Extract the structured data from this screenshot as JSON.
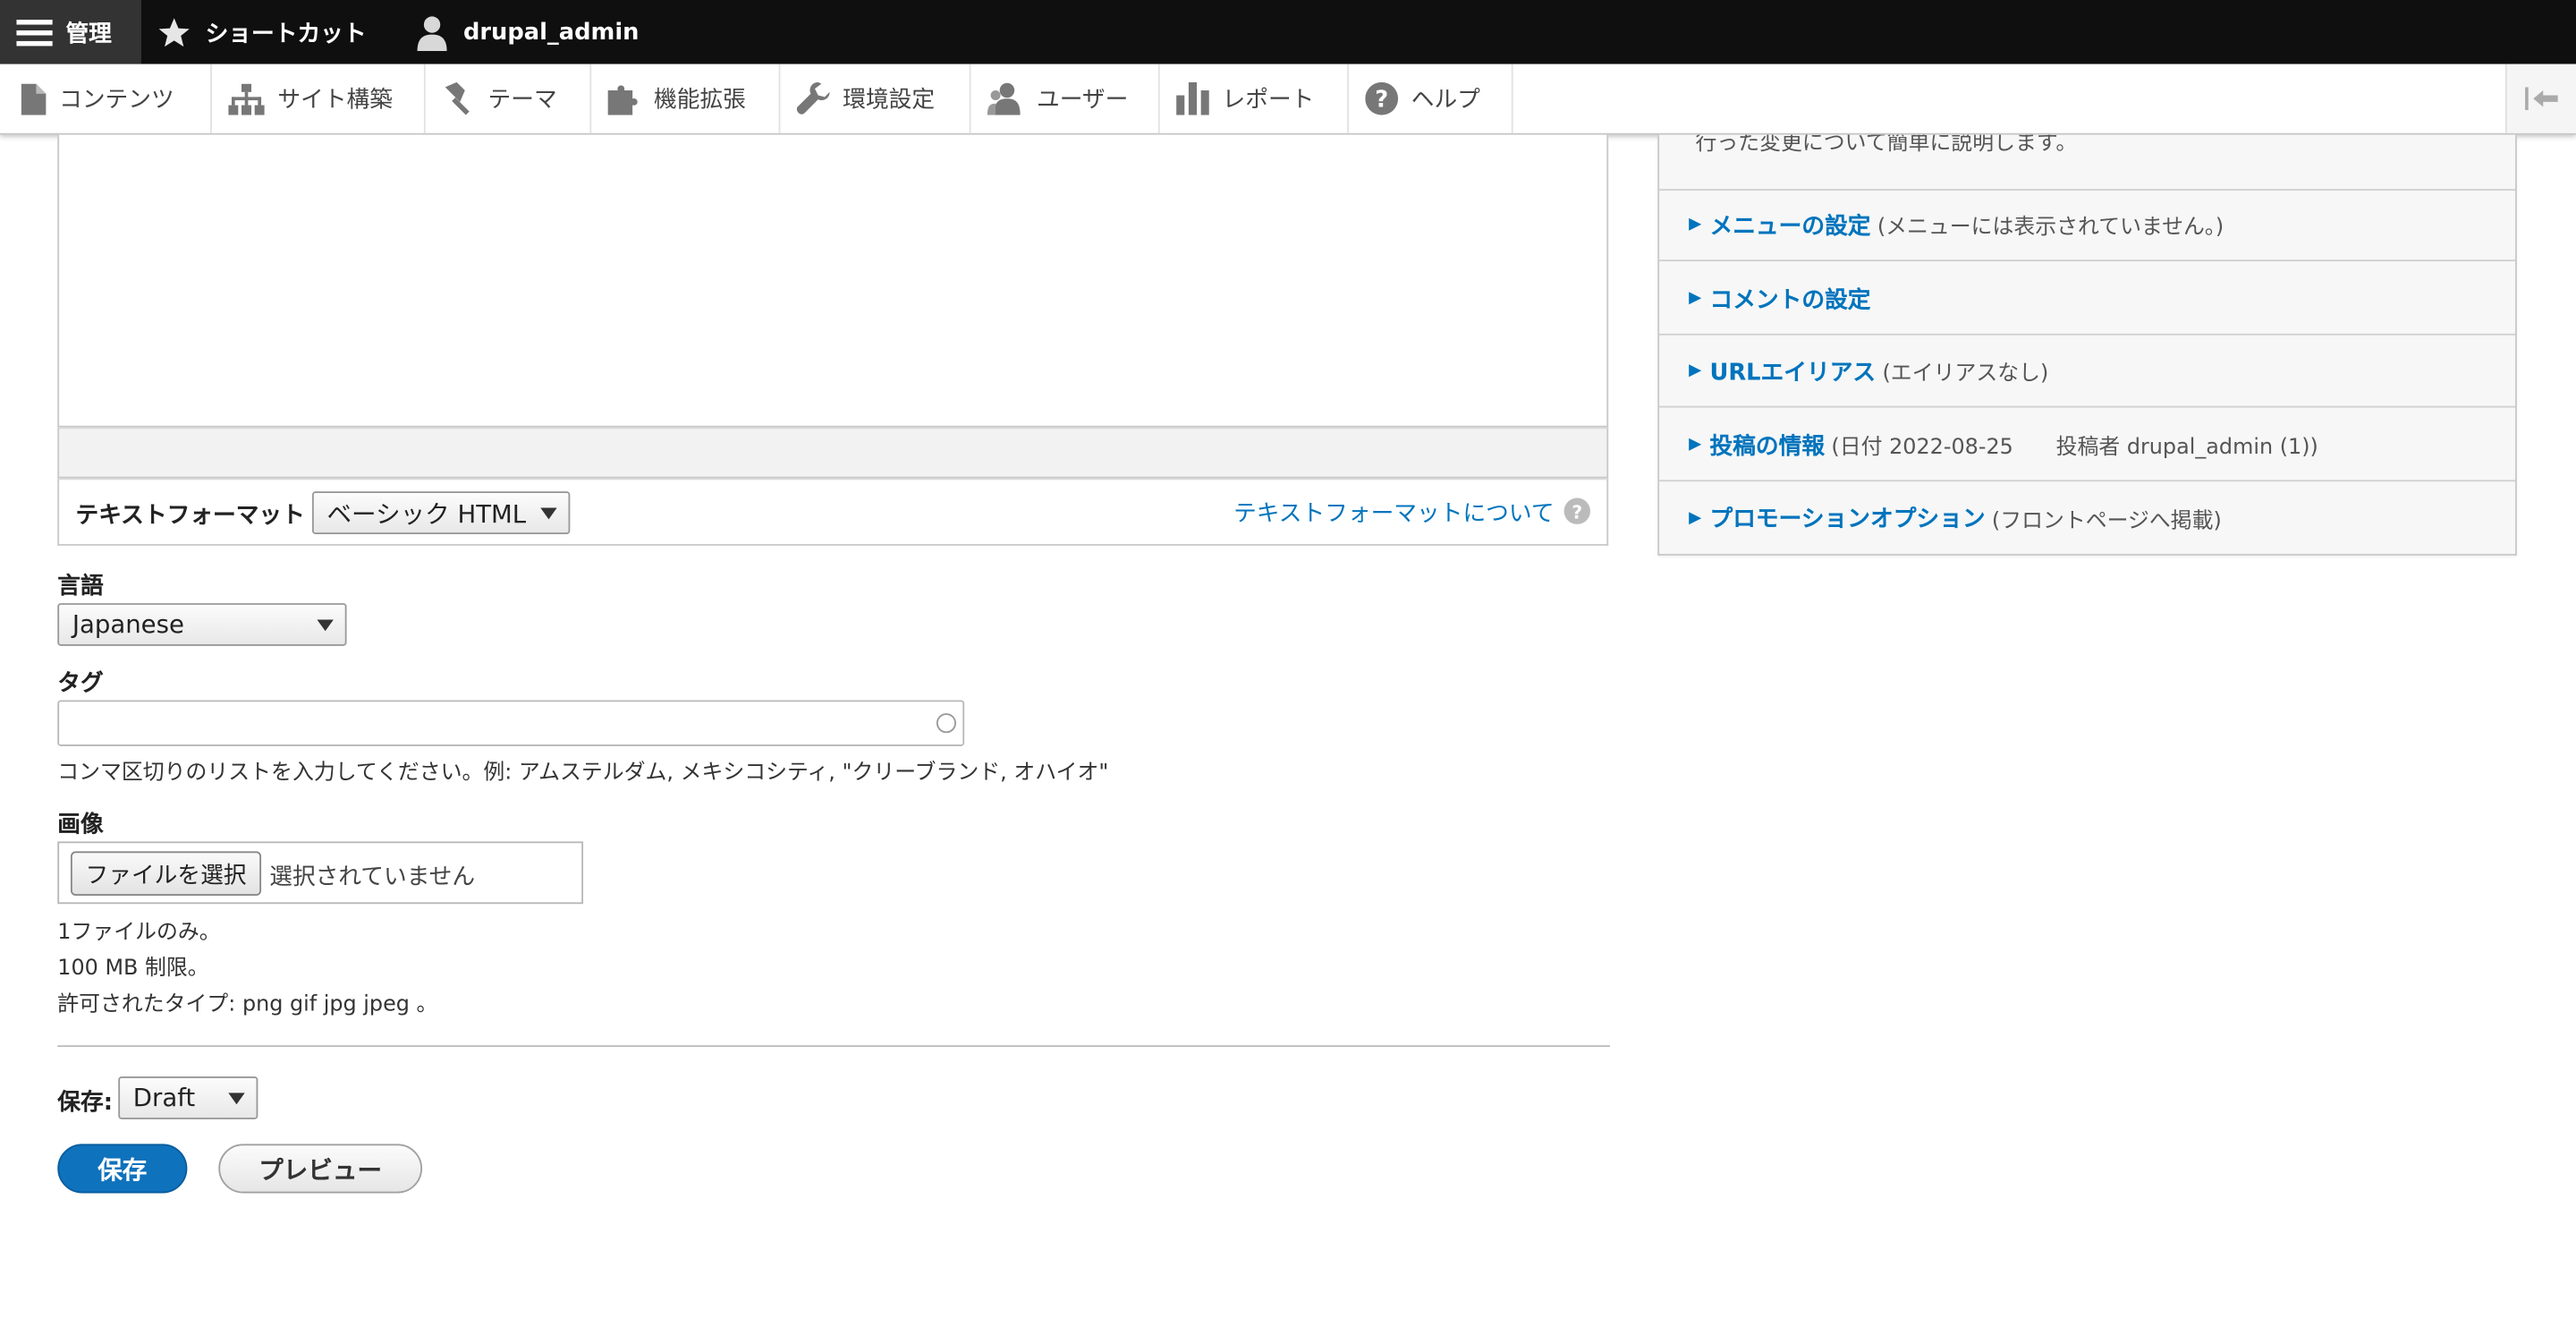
{
  "toolbar": {
    "manage_label": "管理",
    "shortcuts_label": "ショートカット",
    "user_label": "drupal_admin"
  },
  "tray": {
    "items": [
      {
        "label": "コンテンツ",
        "icon": "file-icon"
      },
      {
        "label": "サイト構築",
        "icon": "sitemap-icon"
      },
      {
        "label": "テーマ",
        "icon": "paintbrush-icon"
      },
      {
        "label": "機能拡張",
        "icon": "puzzle-icon"
      },
      {
        "label": "環境設定",
        "icon": "wrench-icon"
      },
      {
        "label": "ユーザー",
        "icon": "people-icon"
      },
      {
        "label": "レポート",
        "icon": "bar-chart-icon"
      },
      {
        "label": "ヘルプ",
        "icon": "help-icon"
      }
    ]
  },
  "form": {
    "text_format_label": "テキストフォーマット",
    "text_format_value": "ベーシック HTML",
    "text_format_help_link": "テキストフォーマットについて",
    "language_label": "言語",
    "language_value": "Japanese",
    "tags_label": "タグ",
    "tags_value": "",
    "tags_help": "コンマ区切りのリストを入力してください。例: アムステルダム, メキシコシティ, \"クリーブランド, オハイオ\"",
    "image_label": "画像",
    "file_button_label": "ファイルを選択",
    "file_status": "選択されていません",
    "file_help_1": "1ファイルのみ。",
    "file_help_2": "100 MB 制限。",
    "file_help_3": "許可されたタイプ: png gif jpg jpeg 。",
    "save_state_label": "保存:",
    "save_state_value": "Draft",
    "save_button": "保存",
    "preview_button": "プレビュー"
  },
  "sidebar": {
    "revision_help": "行った変更について簡単に説明します。",
    "sections": [
      {
        "title": "メニューの設定",
        "summary": "(メニューには表示されていません。)"
      },
      {
        "title": "コメントの設定",
        "summary": ""
      },
      {
        "title": "URLエイリアス",
        "summary": "(エイリアスなし)"
      },
      {
        "title": "投稿の情報",
        "summary": "(日付 2022-08-25　　投稿者 drupal_admin (1))"
      },
      {
        "title": "プロモーションオプション",
        "summary": "(フロントページへ掲載)"
      }
    ]
  },
  "colors": {
    "link": "#0074bd",
    "primary_button": "#0f72bc",
    "toolbar_bg": "#0f0f0f"
  }
}
